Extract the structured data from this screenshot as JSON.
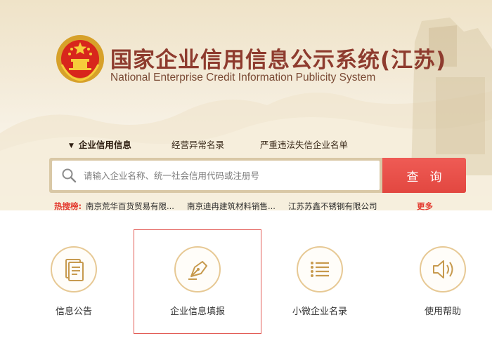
{
  "header": {
    "title_cn": "国家企业信用信息公示系统(江苏)",
    "title_en": "National Enterprise Credit Information Publicity System",
    "emblem_icon": "national-emblem-icon"
  },
  "tabs": [
    {
      "label": "企业信用信息",
      "active": true
    },
    {
      "label": "经营异常名录",
      "active": false
    },
    {
      "label": "严重违法失信企业名单",
      "active": false
    }
  ],
  "search": {
    "placeholder": "请输入企业名称、统一社会信用代码或注册号",
    "value": "",
    "button_label": "查询",
    "icon": "search-icon"
  },
  "hot_search": {
    "label": "热搜榜:",
    "items": [
      "南京荒华百货贸易有限...",
      "南京迪冉建筑材料销售...",
      "江苏苏鑫不锈钢有限公司"
    ],
    "more_label": "更多"
  },
  "services": [
    {
      "label": "信息公告",
      "icon": "notice-document-icon"
    },
    {
      "label": "企业信息填报",
      "icon": "pen-nib-icon"
    },
    {
      "label": "小微企业名录",
      "icon": "list-icon"
    },
    {
      "label": "使用帮助",
      "icon": "speaker-help-icon"
    }
  ],
  "colors": {
    "brand_red": "#e24740",
    "title_brown": "#8e3b2e",
    "icon_gold": "#c79a4e",
    "highlight_border": "#e25b55"
  }
}
